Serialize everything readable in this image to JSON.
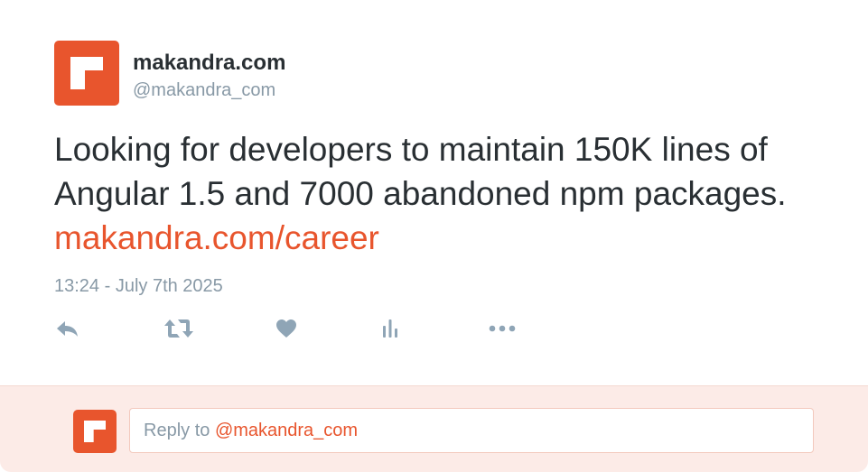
{
  "brand": {
    "accent_color": "#e8552d",
    "logo_icon": "makandra-logo-icon"
  },
  "tweet": {
    "display_name": "makandra.com",
    "handle": "@makandra_com",
    "text": "Looking for developers to maintain 150K lines of Angular 1.5 and 7000 abandoned npm packages.",
    "link": "makandra.com/career",
    "timestamp": "13:24 - July 7th 2025"
  },
  "actions": [
    {
      "name": "reply",
      "icon": "reply-icon"
    },
    {
      "name": "retweet",
      "icon": "retweet-icon"
    },
    {
      "name": "like",
      "icon": "heart-icon"
    },
    {
      "name": "analytics",
      "icon": "bar-chart-icon"
    },
    {
      "name": "more",
      "icon": "more-icon"
    }
  ],
  "reply": {
    "prefix": "Reply to ",
    "mention": "@makandra_com"
  }
}
